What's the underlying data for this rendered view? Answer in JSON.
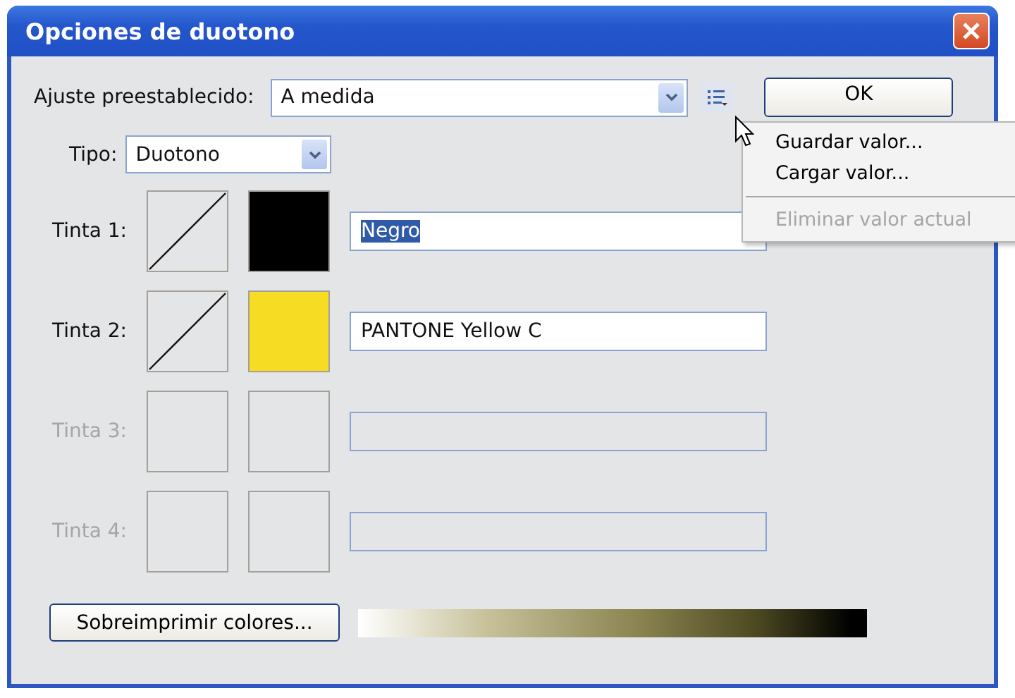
{
  "window": {
    "title": "Opciones de duotono"
  },
  "preset": {
    "label": "Ajuste preestablecido:",
    "value": "A medida"
  },
  "ok_button": "OK",
  "preset_menu": [
    {
      "kind": "item",
      "label": "Guardar valor...",
      "disabled": false
    },
    {
      "kind": "item",
      "label": "Cargar valor...",
      "disabled": false
    },
    {
      "kind": "separator"
    },
    {
      "kind": "item",
      "label": "Eliminar valor actual",
      "disabled": true
    }
  ],
  "type": {
    "label": "Tipo:",
    "value": "Duotono"
  },
  "inks": [
    {
      "label": "Tinta 1:",
      "disabled": false,
      "curve": true,
      "color": "#000000",
      "name": "Negro",
      "name_selected": true
    },
    {
      "label": "Tinta 2:",
      "disabled": false,
      "curve": true,
      "color": "#f6dc22",
      "name": "PANTONE Yellow C",
      "name_selected": false
    },
    {
      "label": "Tinta 3:",
      "disabled": true,
      "curve": false
    },
    {
      "label": "Tinta 4:",
      "disabled": true,
      "curve": false
    }
  ],
  "overprint_button": "Sobreimprimir colores..."
}
